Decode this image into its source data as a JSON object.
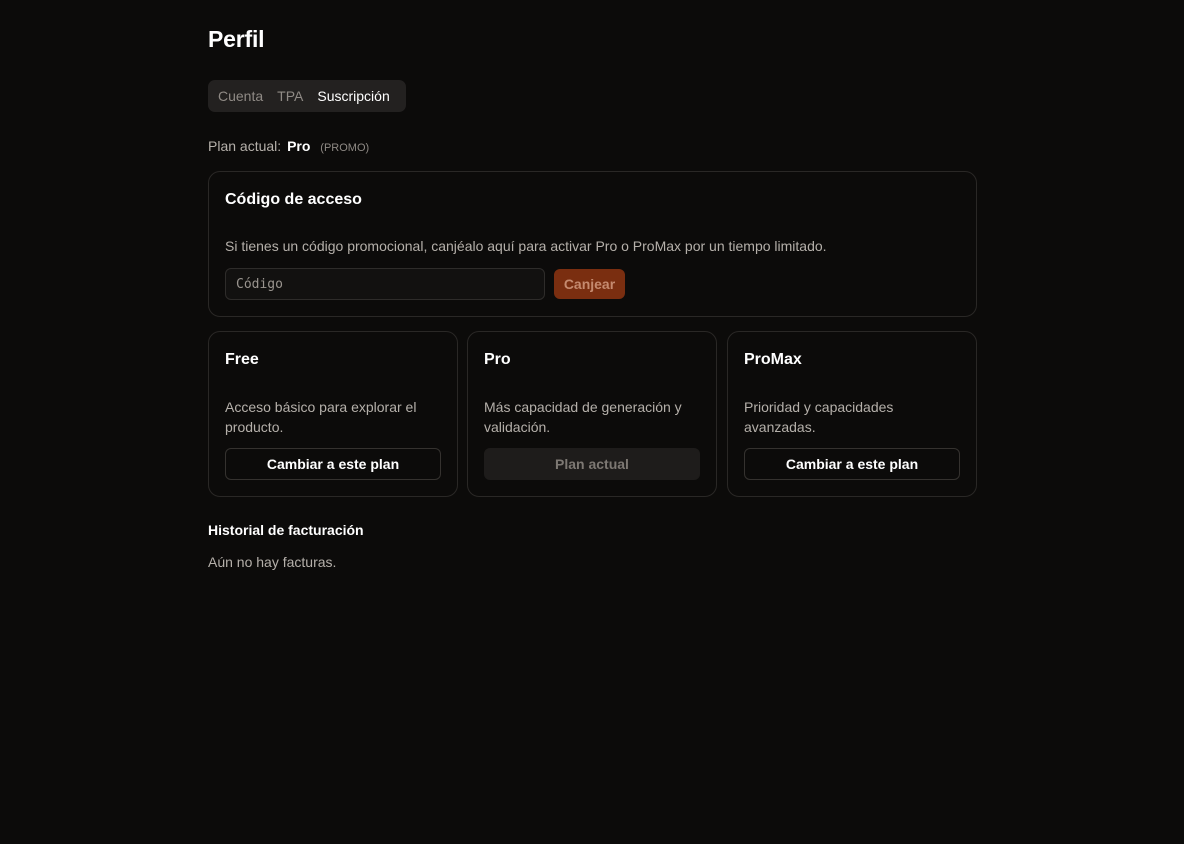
{
  "page": {
    "title": "Perfil"
  },
  "tabs": [
    {
      "label": "Cuenta"
    },
    {
      "label": "TPA"
    },
    {
      "label": "Suscripción",
      "active": true
    }
  ],
  "current_plan": {
    "prefix": "Plan actual:",
    "name": "Pro",
    "tag": "(PROMO)"
  },
  "access_code": {
    "title": "Código de acceso",
    "description": "Si tienes un código promocional, canjéalo aquí para activar Pro o ProMax por un tiempo limitado.",
    "input_placeholder": "Código",
    "input_value": "",
    "redeem_label": "Canjear"
  },
  "plans": [
    {
      "name": "Free",
      "description": "Acceso básico para explorar el producto.",
      "button_label": "Cambiar a este plan",
      "is_current": false
    },
    {
      "name": "Pro",
      "description": "Más capacidad de generación y validación.",
      "button_label": "Plan actual",
      "is_current": true
    },
    {
      "name": "ProMax",
      "description": "Prioridad y capacidades avanzadas.",
      "button_label": "Cambiar a este plan",
      "is_current": false
    }
  ],
  "billing": {
    "title": "Historial de facturación",
    "empty_text": "Aún no hay facturas."
  },
  "colors": {
    "background": "#0c0b0a",
    "accent": "#7a2e10",
    "card_border": "#2a2826"
  }
}
